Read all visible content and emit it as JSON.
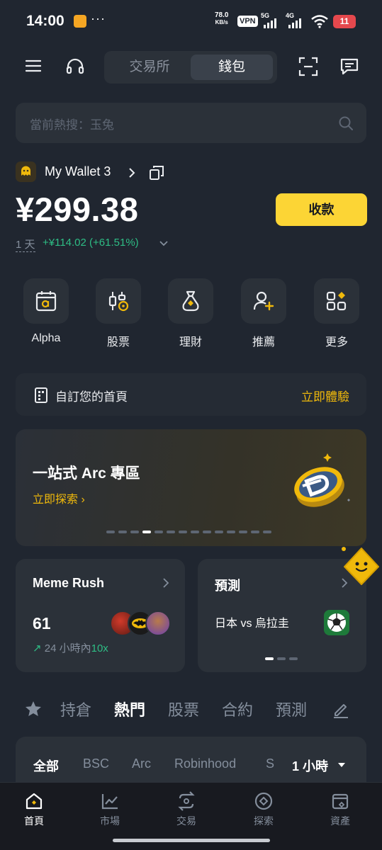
{
  "status_bar": {
    "time": "14:00",
    "dots": "···",
    "speed_value": "78.0",
    "speed_unit": "KB/s",
    "vpn": "VPN",
    "net1": "5G",
    "net2": "4G",
    "battery": "11"
  },
  "header": {
    "tabs": [
      {
        "label": "交易所",
        "active": false
      },
      {
        "label": "錢包",
        "active": true
      }
    ]
  },
  "search": {
    "placeholder": "當前熱搜：玉兔"
  },
  "wallet": {
    "name": "My Wallet 3",
    "balance": "¥299.38",
    "receive_label": "收款",
    "period": "1 天",
    "change": "+¥114.02 (+61.51%)"
  },
  "actions": [
    {
      "label": "Alpha",
      "icon": "alpha-calendar-icon"
    },
    {
      "label": "股票",
      "icon": "stocks-icon"
    },
    {
      "label": "理財",
      "icon": "finance-bag-icon"
    },
    {
      "label": "推薦",
      "icon": "referral-icon"
    },
    {
      "label": "更多",
      "icon": "more-grid-icon"
    }
  ],
  "customize": {
    "label": "自訂您的首頁",
    "link": "立即體驗"
  },
  "banner": {
    "title": "一站式 Arc 專區",
    "link": "立即探索",
    "slide_count": 14,
    "active_slide": 4
  },
  "meme_card": {
    "title": "Meme Rush",
    "count": "61",
    "trend_prefix": "24 小時內",
    "trend_value": "10x"
  },
  "predict_card": {
    "title": "預測",
    "match": "日本 vs 烏拉圭"
  },
  "market_tabs": [
    {
      "label": "持倉",
      "active": false
    },
    {
      "label": "熱門",
      "active": true
    },
    {
      "label": "股票",
      "active": false
    },
    {
      "label": "合約",
      "active": false
    },
    {
      "label": "預測",
      "active": false
    }
  ],
  "filters": [
    {
      "label": "全部",
      "active": true
    },
    {
      "label": "BSC",
      "active": false
    },
    {
      "label": "Arc",
      "active": false
    },
    {
      "label": "Robinhood",
      "active": false
    },
    {
      "label": "S",
      "active": false
    }
  ],
  "timeframe": "1 小時",
  "bottom_nav": [
    {
      "label": "首頁",
      "active": true
    },
    {
      "label": "市場",
      "active": false
    },
    {
      "label": "交易",
      "active": false
    },
    {
      "label": "探索",
      "active": false
    },
    {
      "label": "資產",
      "active": false
    }
  ],
  "colors": {
    "background": "#202630",
    "card": "#2B3139",
    "accent": "#FCD535",
    "positive": "#2EBD85",
    "muted": "#848E9C"
  }
}
